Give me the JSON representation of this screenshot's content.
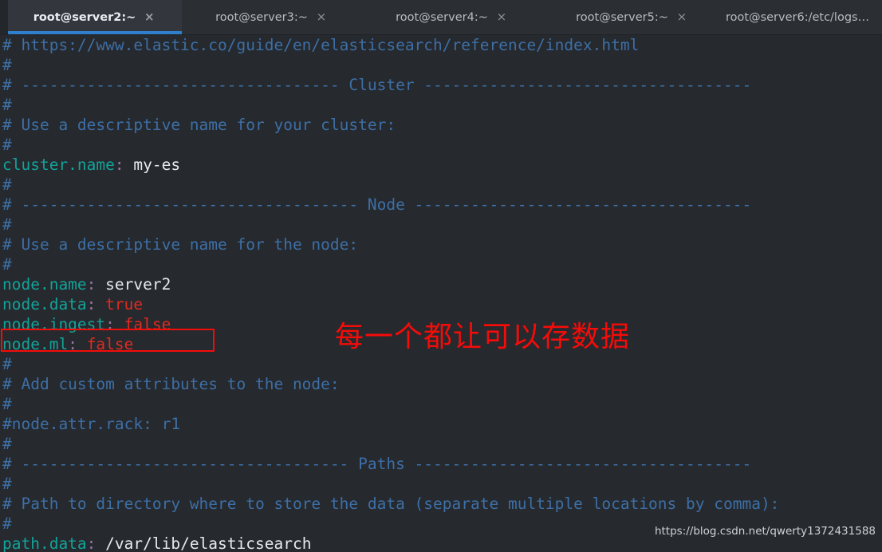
{
  "window": {
    "app_kind": "terminal-emulator",
    "accent_color": "#2f7fcc",
    "terminal_background": "#26292e",
    "tabbar_background": "#2b2e33"
  },
  "tabbar": {
    "close_glyph": "×",
    "tabs": [
      {
        "label": "root@server2:~",
        "active": true,
        "has_close": true
      },
      {
        "label": "root@server3:~",
        "active": false,
        "has_close": true
      },
      {
        "label": "root@server4:~",
        "active": false,
        "has_close": true
      },
      {
        "label": "root@server5:~",
        "active": false,
        "has_close": true
      },
      {
        "label": "root@server6:/etc/logs…",
        "active": false,
        "has_close": false
      }
    ]
  },
  "terminal": {
    "file_kind": "elasticsearch.yml",
    "syntax_colors": {
      "comment": "#3d6fa5",
      "key": "#12a39a",
      "colon": "#9a77a8",
      "value": "#e6e9ee",
      "boolean": "#e02b20"
    },
    "lines": [
      {
        "type": "comment",
        "text": "# https://www.elastic.co/guide/en/elasticsearch/reference/index.html"
      },
      {
        "type": "comment",
        "text": "#"
      },
      {
        "type": "comment",
        "text": "# ---------------------------------- Cluster -----------------------------------"
      },
      {
        "type": "comment",
        "text": "#"
      },
      {
        "type": "comment",
        "text": "# Use a descriptive name for your cluster:"
      },
      {
        "type": "comment",
        "text": "#"
      },
      {
        "type": "setting",
        "key": "cluster.name",
        "value": "my-es",
        "value_kind": "plain"
      },
      {
        "type": "comment",
        "text": "#"
      },
      {
        "type": "comment",
        "text": "# ------------------------------------ Node ------------------------------------"
      },
      {
        "type": "comment",
        "text": "#"
      },
      {
        "type": "comment",
        "text": "# Use a descriptive name for the node:"
      },
      {
        "type": "comment",
        "text": "#"
      },
      {
        "type": "setting",
        "key": "node.name",
        "value": "server2",
        "value_kind": "plain"
      },
      {
        "type": "setting",
        "key": "node.data",
        "value": "true",
        "value_kind": "boolean",
        "highlighted": true
      },
      {
        "type": "setting",
        "key": "node.ingest",
        "value": "false",
        "value_kind": "boolean"
      },
      {
        "type": "setting",
        "key": "node.ml",
        "value": "false",
        "value_kind": "boolean"
      },
      {
        "type": "comment",
        "text": "#"
      },
      {
        "type": "comment",
        "text": "# Add custom attributes to the node:"
      },
      {
        "type": "comment",
        "text": "#"
      },
      {
        "type": "comment",
        "text": "#node.attr.rack: r1"
      },
      {
        "type": "comment",
        "text": "#"
      },
      {
        "type": "comment",
        "text": "# ----------------------------------- Paths ------------------------------------"
      },
      {
        "type": "comment",
        "text": "#"
      },
      {
        "type": "comment",
        "text": "# Path to directory where to store the data (separate multiple locations by comma):"
      },
      {
        "type": "comment",
        "text": "#"
      },
      {
        "type": "setting",
        "key": "path.data",
        "value": "/var/lib/elasticsearch",
        "value_kind": "plain"
      }
    ]
  },
  "annotations": {
    "highlight_box": {
      "target_line": "node.data: true",
      "color": "#f40c09"
    },
    "note": {
      "text": "每一个都让可以存数据",
      "color": "#f40c09"
    },
    "watermark": {
      "text": "https://blog.csdn.net/qwerty1372431588"
    }
  }
}
